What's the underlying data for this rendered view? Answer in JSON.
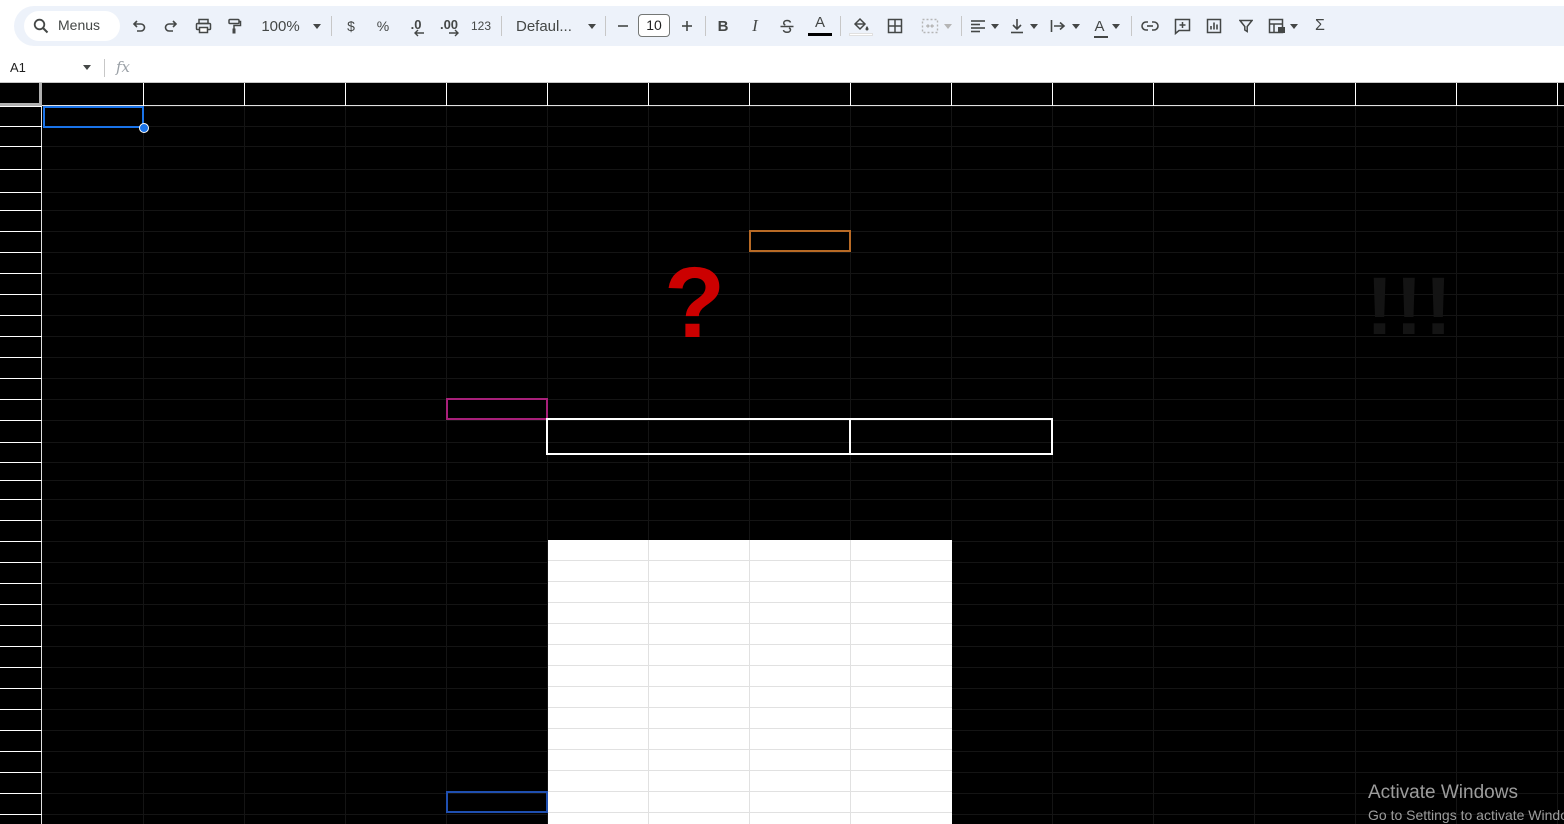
{
  "toolbar": {
    "search_label": "Menus",
    "zoom": "100%",
    "currency_symbol": "$",
    "percent_symbol": "%",
    "decrease_decimal": ".0",
    "increase_decimal": ".00",
    "number_format": "123",
    "font_family": "Defaul...",
    "font_size": "10",
    "bold": "B",
    "italic": "I",
    "text_color_glyph": "A",
    "sum_glyph": "Σ",
    "text_rotation_glyph": "A"
  },
  "formula_bar": {
    "name_box": "A1",
    "fx_label": "fx",
    "formula": ""
  },
  "canvas": {
    "question_mark": "?",
    "exclamation": "!!!"
  },
  "watermark": {
    "title": "Activate Windows",
    "subtitle": "Go to Settings to activate Windows."
  },
  "colors": {
    "accent": "#1a73e8",
    "grid_background": "#000000",
    "question_mark": "#cc0000",
    "orange_border": "#b86a25",
    "magenta_border": "#a8207a"
  }
}
